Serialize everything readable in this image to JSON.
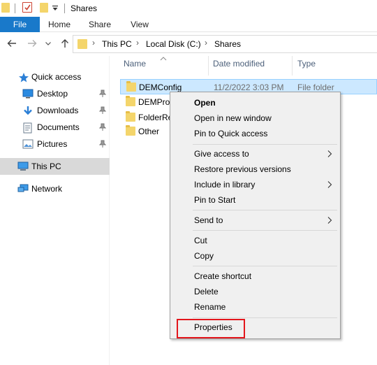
{
  "window": {
    "title": "Shares"
  },
  "ribbon": {
    "tabs": [
      "File",
      "Home",
      "Share",
      "View"
    ]
  },
  "address": {
    "crumbs": [
      "This PC",
      "Local Disk (C:)",
      "Shares"
    ]
  },
  "sidebar": {
    "items": [
      {
        "label": "Quick access",
        "icon": "star-icon"
      },
      {
        "label": "Desktop",
        "icon": "desktop-icon",
        "pinned": true
      },
      {
        "label": "Downloads",
        "icon": "download-icon",
        "pinned": true
      },
      {
        "label": "Documents",
        "icon": "documents-icon",
        "pinned": true
      },
      {
        "label": "Pictures",
        "icon": "pictures-icon",
        "pinned": true
      },
      {
        "label": "This PC",
        "icon": "computer-icon",
        "selected": true
      },
      {
        "label": "Network",
        "icon": "network-icon"
      }
    ]
  },
  "columns": {
    "name": "Name",
    "date": "Date modified",
    "type": "Type"
  },
  "files": [
    {
      "name": "DEMConfig",
      "date": "11/2/2022 3:03 PM",
      "type": "File folder",
      "selected": true
    },
    {
      "name": "DEMProf",
      "date": "",
      "type": ""
    },
    {
      "name": "FolderRe",
      "date": "",
      "type": ""
    },
    {
      "name": "Other",
      "date": "",
      "type": ""
    }
  ],
  "context_menu": {
    "groups": [
      [
        "Open",
        "Open in new window",
        "Pin to Quick access"
      ],
      [
        "Give access to",
        "Restore previous versions",
        "Include in library",
        "Pin to Start"
      ],
      [
        "Send to"
      ],
      [
        "Cut",
        "Copy"
      ],
      [
        "Create shortcut",
        "Delete",
        "Rename"
      ],
      [
        "Properties"
      ]
    ],
    "highlighted": "Properties"
  },
  "colors": {
    "accent": "#1979ca",
    "selection": "#cce8ff",
    "highlight": "#e3161c",
    "folder": "#f4d56b"
  }
}
